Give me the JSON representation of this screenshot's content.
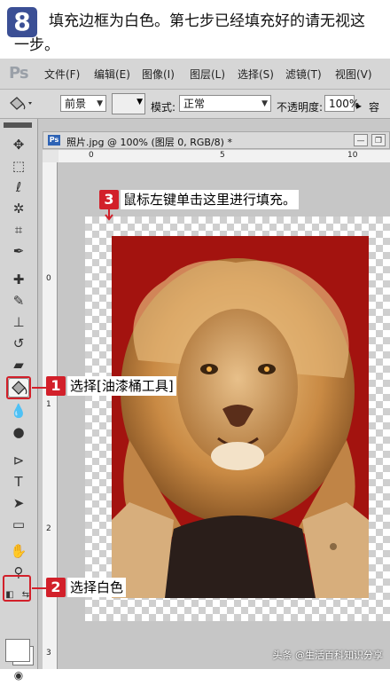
{
  "instruction": {
    "step_number": "8",
    "text_line1": "填充边框为白色。第七步已经填充好的请无视这",
    "text_line2": "一步。"
  },
  "app": {
    "logo": "Ps",
    "menu": [
      "文件(F)",
      "编辑(E)",
      "图像(I)",
      "图层(L)",
      "选择(S)",
      "滤镜(T)",
      "视图(V)"
    ]
  },
  "options_bar": {
    "fill_source": "前景",
    "mode_label": "模式:",
    "mode_value": "正常",
    "opacity_label": "不透明度:",
    "opacity_value": "100%",
    "tolerance_label": "容"
  },
  "document": {
    "title": "照片.jpg @ 100% (图层 0, RGB/8) *",
    "ruler_top": [
      "0",
      "5",
      "10"
    ],
    "ruler_left": [
      "0",
      "1",
      "2",
      "3"
    ]
  },
  "annotations": [
    {
      "number": "3",
      "text": "鼠标左键单击这里进行填充。"
    },
    {
      "number": "1",
      "text": "选择[油漆桶工具]"
    },
    {
      "number": "2",
      "text": "选择白色"
    }
  ],
  "colors": {
    "badge_blue": "#3b4f95",
    "annotation_red": "#d2202a",
    "photo_background": "#a3130f"
  },
  "icons": [
    "move-icon",
    "marquee-icon",
    "lasso-icon",
    "magic-wand-icon",
    "crop-icon",
    "eyedropper-icon",
    "healing-icon",
    "brush-icon",
    "stamp-icon",
    "history-brush-icon",
    "eraser-icon",
    "paint-bucket-icon",
    "dodge-icon",
    "path-select-icon",
    "type-icon",
    "direct-select-icon",
    "shape-icon",
    "hand-icon",
    "zoom-icon"
  ],
  "watermark": "头条 @生活百科知识分享"
}
